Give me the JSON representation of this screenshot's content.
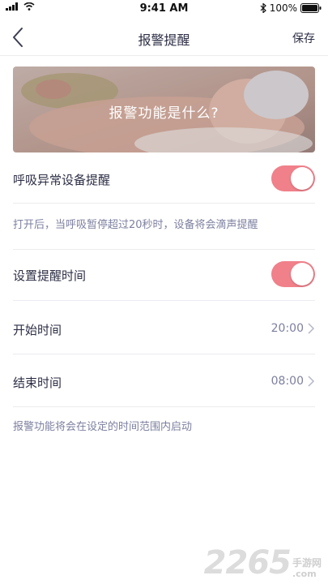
{
  "status_bar": {
    "time": "9:41 AM",
    "battery": "100%",
    "icons": [
      "signal-icon",
      "wifi-icon",
      "bluetooth-icon",
      "battery-icon"
    ]
  },
  "nav": {
    "title": "报警提醒",
    "save_label": "保存",
    "back_icon": "chevron-left-icon"
  },
  "banner": {
    "title": "报警功能是什么?"
  },
  "settings": {
    "breath_alert_label": "呼吸异常设备提醒",
    "breath_alert_on": true,
    "breath_hint": "打开后，当呼吸暂停超过20秒时，设备将会滴声提醒",
    "schedule_label": "设置提醒时间",
    "schedule_on": true,
    "start_label": "开始时间",
    "start_value": "20:00",
    "end_label": "结束时间",
    "end_value": "08:00",
    "schedule_hint": "报警功能将会在设定的时间范围内启动"
  },
  "colors": {
    "toggle_on": "#f0808a",
    "text_primary": "#2d2f45",
    "text_secondary": "#7d80a0"
  },
  "watermark": {
    "number": "2265",
    "cn": "手游网",
    "domain": ".com"
  }
}
